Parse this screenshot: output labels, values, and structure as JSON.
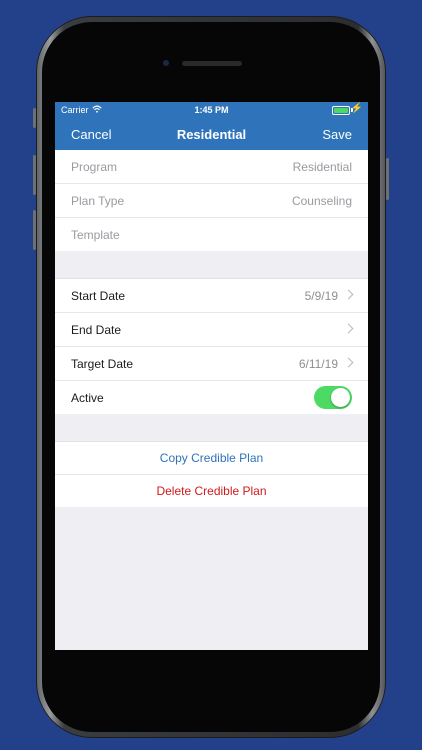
{
  "status_bar": {
    "carrier": "Carrier",
    "time": "1:45 PM",
    "wifi_icon": "wifi-icon",
    "battery_icon": "battery-icon",
    "charging_icon": "charging-icon"
  },
  "nav": {
    "cancel_label": "Cancel",
    "title": "Residential",
    "save_label": "Save"
  },
  "plan_info": [
    {
      "label": "Program",
      "value": "Residential"
    },
    {
      "label": "Plan Type",
      "value": "Counseling"
    },
    {
      "label": "Template",
      "value": ""
    }
  ],
  "dates": [
    {
      "label": "Start Date",
      "value": "5/9/19"
    },
    {
      "label": "End Date",
      "value": ""
    },
    {
      "label": "Target Date",
      "value": "6/11/19"
    }
  ],
  "active": {
    "label": "Active",
    "on": true
  },
  "actions": {
    "copy_label": "Copy Credible Plan",
    "delete_label": "Delete Credible Plan"
  },
  "colors": {
    "background": "#23408a",
    "nav_bar": "#2f74ba",
    "toggle_on": "#4cd964",
    "delete": "#d0191c"
  }
}
